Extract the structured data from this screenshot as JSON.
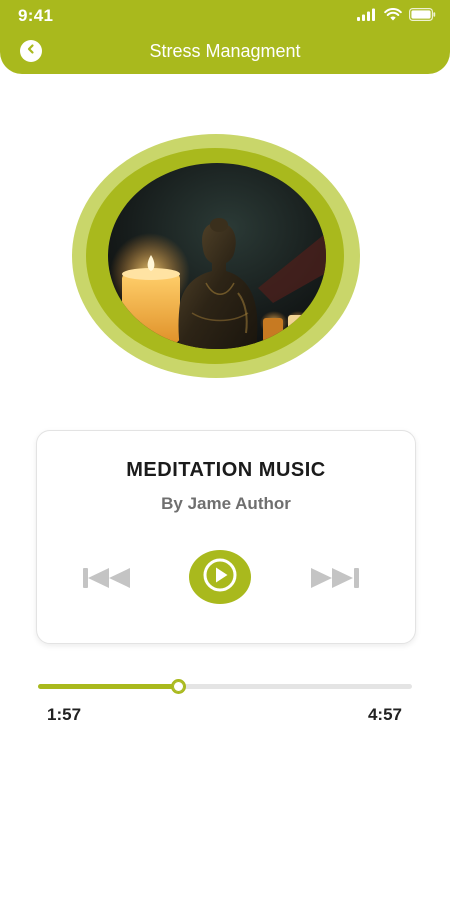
{
  "status_bar": {
    "time": "9:41",
    "icons": [
      "signal-icon",
      "wifi-icon",
      "battery-icon"
    ]
  },
  "header": {
    "title": "Stress Managment",
    "back_icon": "chevron-left-icon"
  },
  "artwork": {
    "icon": "buddha-candle-image"
  },
  "player": {
    "title": "MEDITATION MUSIC",
    "author": "By Jame Author",
    "prev_icon": "skip-previous-icon",
    "play_icon": "play-icon",
    "next_icon": "skip-next-icon"
  },
  "progress": {
    "current_time": "1:57",
    "total_time": "4:57",
    "fraction": 0.375
  },
  "colors": {
    "accent": "#a9b91d",
    "accent_light": "#c9d66a",
    "control_gray": "#c4c4c4"
  }
}
